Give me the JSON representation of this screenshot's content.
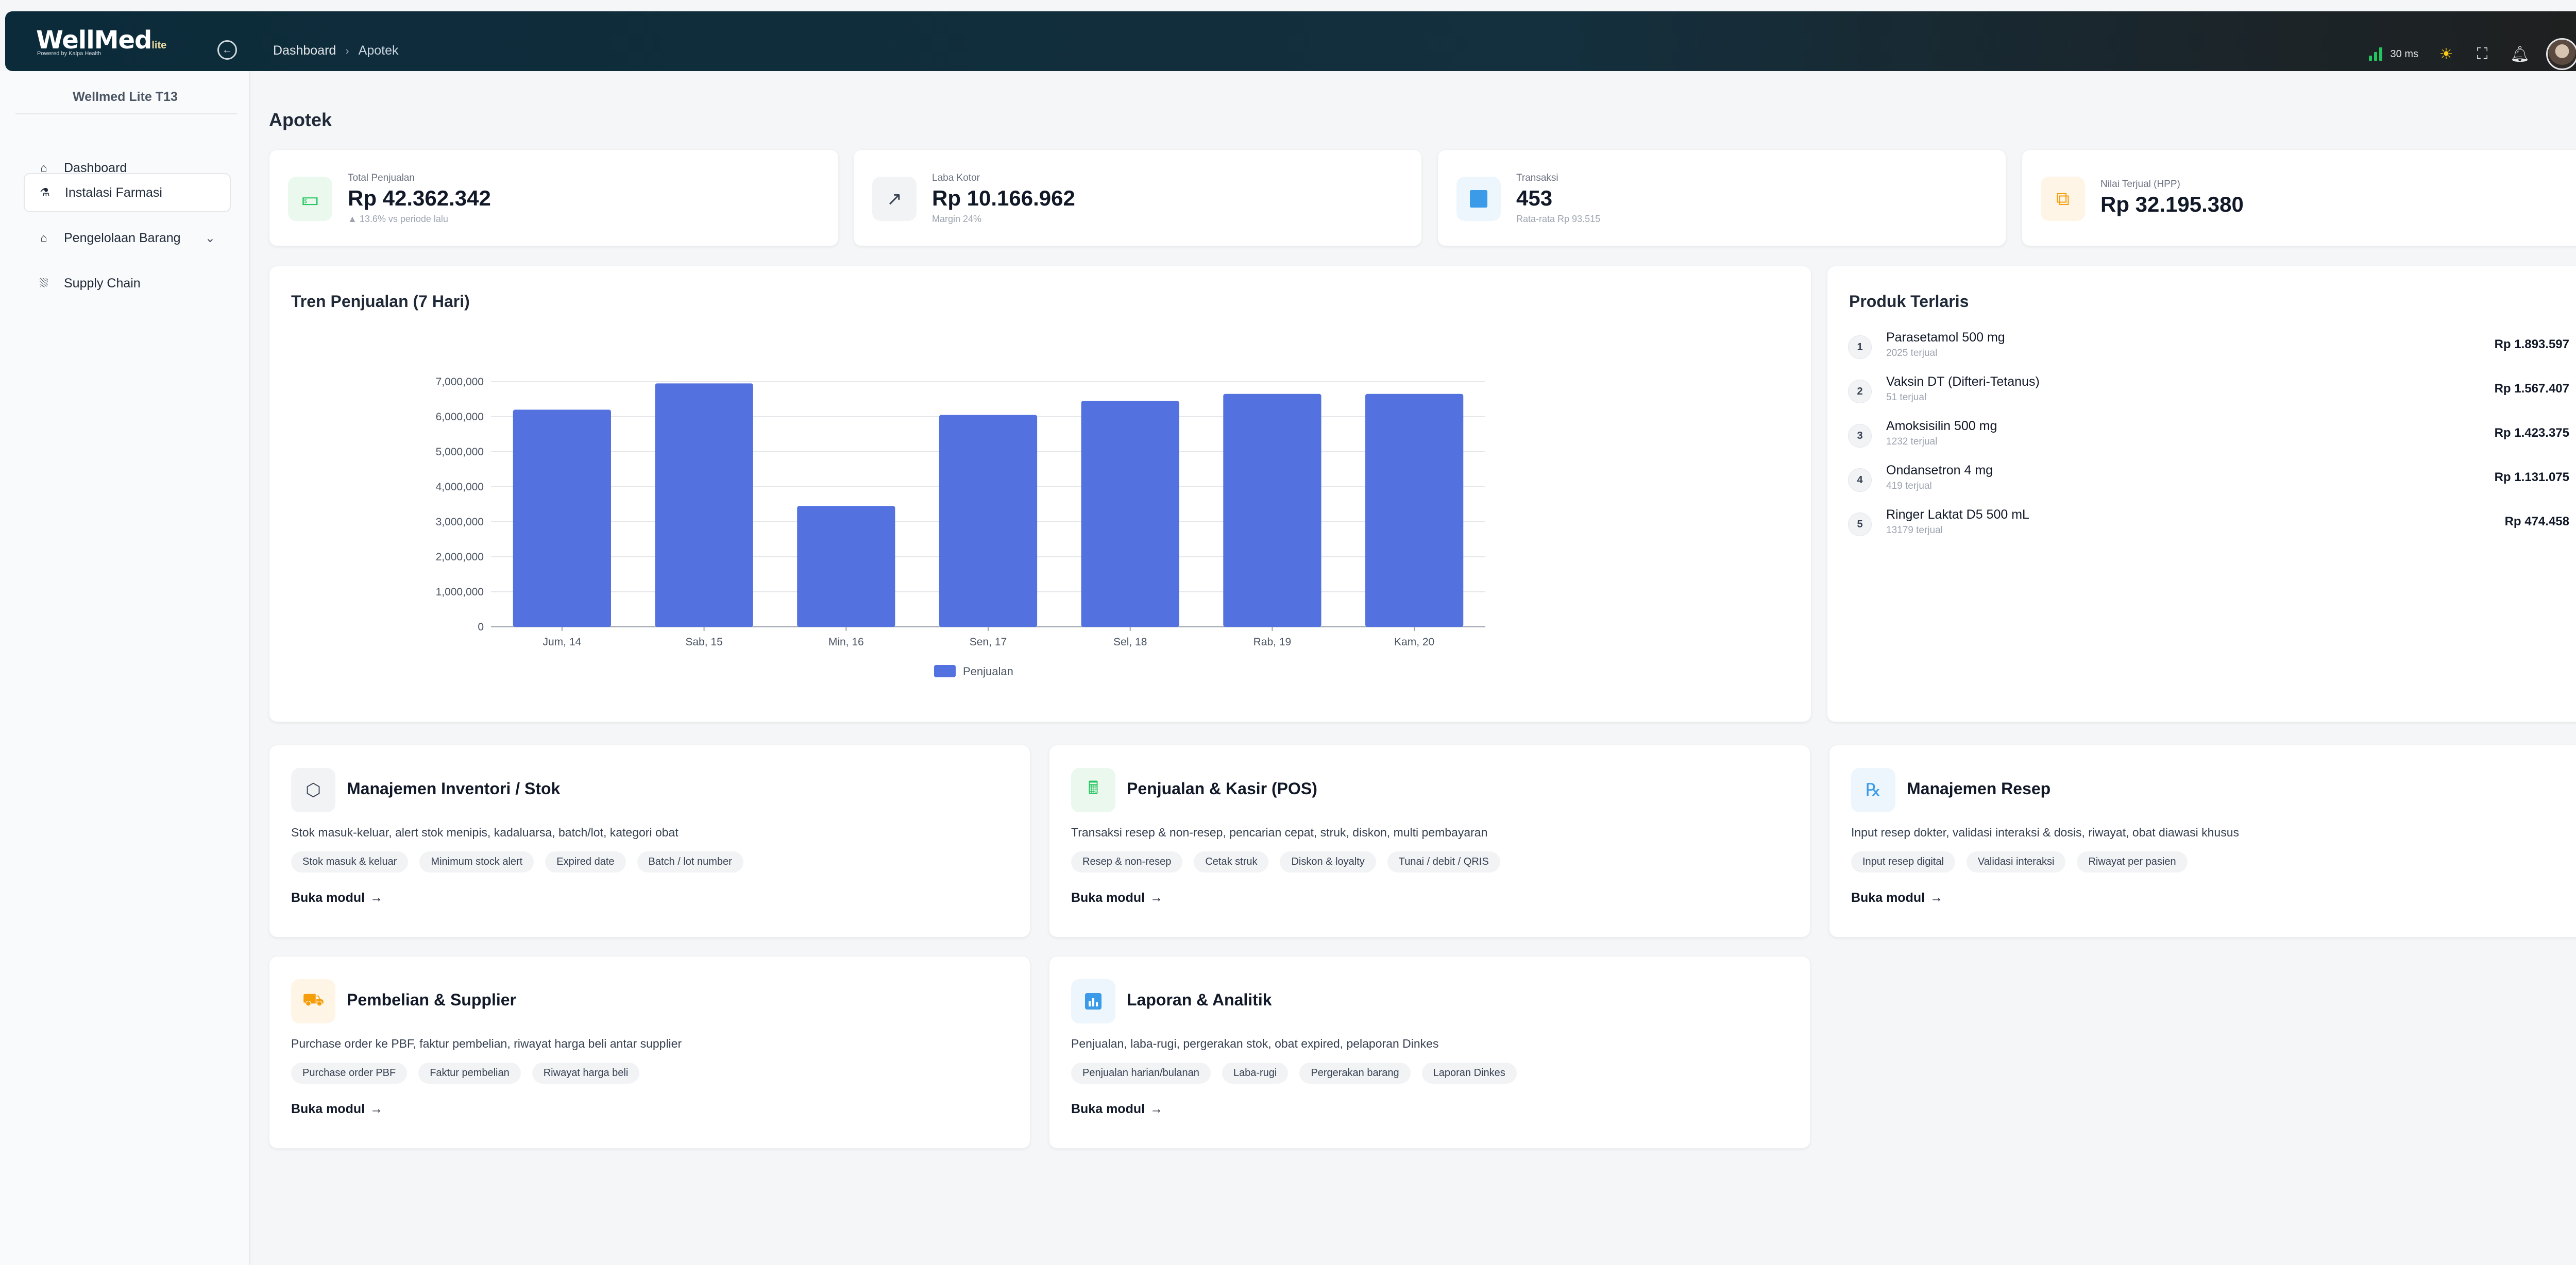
{
  "app": {
    "logo_main": "WellMed",
    "logo_suffix": "lite",
    "logo_sub": "Powered by Kalpa Health"
  },
  "header": {
    "breadcrumb": [
      "Dashboard",
      "Apotek"
    ],
    "latency": "30 ms"
  },
  "sidebar": {
    "org_name": "Wellmed Lite T13",
    "items": [
      {
        "label": "Dashboard",
        "icon": "home-icon"
      },
      {
        "label": "Instalasi Farmasi",
        "icon": "pharmacy-icon",
        "active": true
      },
      {
        "label": "Pengelolaan Barang",
        "icon": "warehouse-icon",
        "expandable": true
      },
      {
        "label": "Supply Chain",
        "icon": "supply-chain-icon"
      }
    ]
  },
  "page": {
    "title": "Apotek"
  },
  "stats": [
    {
      "label": "Total Penjualan",
      "value": "Rp 42.362.342",
      "sub": "13.6% vs periode lalu",
      "icon": "money-icon",
      "color": "#22c55e"
    },
    {
      "label": "Laba Kotor",
      "value": "Rp 10.166.962",
      "sub": "Margin 24%",
      "icon": "trend-up-icon",
      "color": "#374151"
    },
    {
      "label": "Transaksi",
      "value": "453",
      "sub": "Rata-rata Rp 93.515",
      "icon": "square-icon",
      "color": "#3b9be8"
    },
    {
      "label": "Nilai Terjual (HPP)",
      "value": "Rp 32.195.380",
      "sub": "",
      "icon": "box-icon",
      "color": "#f59e0b"
    }
  ],
  "sales_trend": {
    "title": "Tren Penjualan (7 Hari)"
  },
  "chart_data": {
    "type": "bar",
    "title": "Tren Penjualan (7 Hari)",
    "categories": [
      "Jum, 14",
      "Sab, 15",
      "Min, 16",
      "Sen, 17",
      "Sel, 18",
      "Rab, 19",
      "Kam, 20"
    ],
    "series": [
      {
        "name": "Penjualan",
        "values": [
          6200000,
          6950000,
          3450000,
          6050000,
          6450000,
          6650000,
          6650000
        ],
        "color": "#5471e0"
      }
    ],
    "yticks": [
      "0",
      "1,000,000",
      "2,000,000",
      "3,000,000",
      "4,000,000",
      "5,000,000",
      "6,000,000",
      "7,000,000"
    ],
    "ylim": [
      0,
      7000000
    ],
    "grid": true,
    "legend": "bottom"
  },
  "top_products": {
    "title": "Produk Terlaris",
    "items": [
      {
        "rank": "1",
        "name": "Parasetamol 500 mg",
        "sold": "2025 terjual",
        "amount": "Rp 1.893.597"
      },
      {
        "rank": "2",
        "name": "Vaksin DT (Difteri-Tetanus)",
        "sold": "51 terjual",
        "amount": "Rp 1.567.407"
      },
      {
        "rank": "3",
        "name": "Amoksisilin 500 mg",
        "sold": "1232 terjual",
        "amount": "Rp 1.423.375"
      },
      {
        "rank": "4",
        "name": "Ondansetron 4 mg",
        "sold": "419 terjual",
        "amount": "Rp 1.131.075"
      },
      {
        "rank": "5",
        "name": "Ringer Laktat D5 500 mL",
        "sold": "13179 terjual",
        "amount": "Rp 474.458"
      }
    ]
  },
  "modules": [
    {
      "title": "Manajemen Inventori / Stok",
      "desc": "Stok masuk-keluar, alert stok menipis, kadaluarsa, batch/lot, kategori obat",
      "tags": [
        "Stok masuk & keluar",
        "Minimum stock alert",
        "Expired date",
        "Batch / lot number"
      ],
      "link": "Buka modul",
      "icon": "cube-icon",
      "color": "#374151"
    },
    {
      "title": "Penjualan & Kasir (POS)",
      "desc": "Transaksi resep & non-resep, pencarian cepat, struk, diskon, multi pembayaran",
      "tags": [
        "Resep & non-resep",
        "Cetak struk",
        "Diskon & loyalty",
        "Tunai / debit / QRIS"
      ],
      "link": "Buka modul",
      "icon": "cash-register-icon",
      "color": "#22c55e"
    },
    {
      "title": "Manajemen Resep",
      "desc": "Input resep dokter, validasi interaksi & dosis, riwayat, obat diawasi khusus",
      "tags": [
        "Input resep digital",
        "Validasi interaksi",
        "Riwayat per pasien"
      ],
      "link": "Buka modul",
      "icon": "prescription-icon",
      "color": "#3b9be8"
    },
    {
      "title": "Pembelian & Supplier",
      "desc": "Purchase order ke PBF, faktur pembelian, riwayat harga beli antar supplier",
      "tags": [
        "Purchase order PBF",
        "Faktur pembelian",
        "Riwayat harga beli"
      ],
      "link": "Buka modul",
      "icon": "truck-icon",
      "color": "#f59e0b"
    },
    {
      "title": "Laporan & Analitik",
      "desc": "Penjualan, laba-rugi, pergerakan stok, obat expired, pelaporan Dinkes",
      "tags": [
        "Penjualan harian/bulanan",
        "Laba-rugi",
        "Pergerakan barang",
        "Laporan Dinkes"
      ],
      "link": "Buka modul",
      "icon": "bar-chart-icon",
      "color": "#3b9be8"
    }
  ]
}
